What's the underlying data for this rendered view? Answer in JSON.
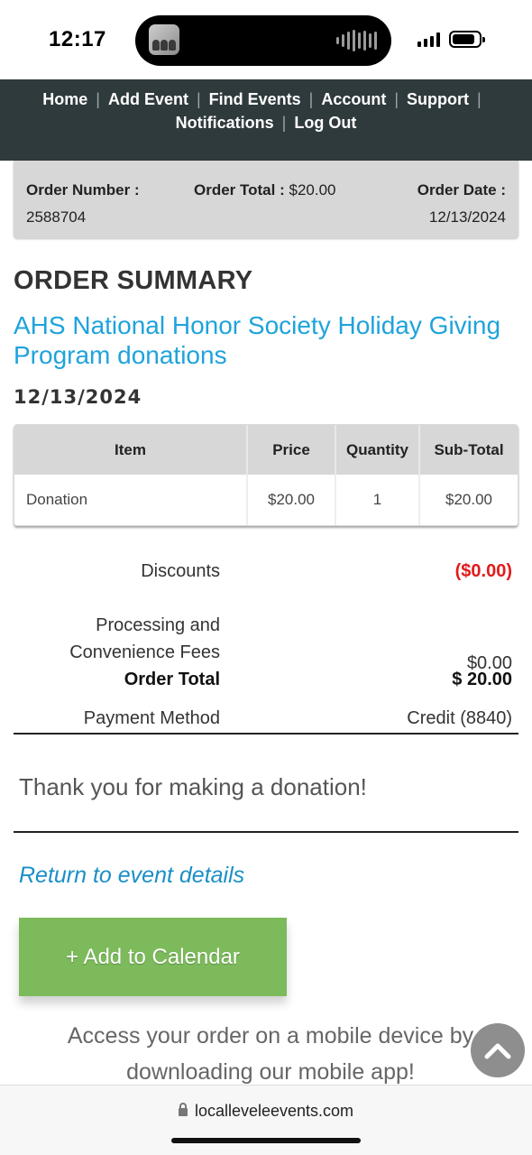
{
  "status": {
    "time": "12:17"
  },
  "nav": {
    "items": [
      "Home",
      "Add Event",
      "Find Events",
      "Account",
      "Support",
      "Notifications",
      "Log Out"
    ],
    "separator": "|"
  },
  "order_info": {
    "number_label": "Order Number :",
    "number": "2588704",
    "total_label": "Order Total :",
    "total": "$20.00",
    "date_label": "Order Date :",
    "date": "12/13/2024"
  },
  "summary": {
    "heading": "ORDER SUMMARY",
    "event_title": "AHS National Honor Society Holiday Giving Program donations",
    "event_date": "12/13/2024"
  },
  "table": {
    "headers": [
      "Item",
      "Price",
      "Quantity",
      "Sub-Total"
    ],
    "rows": [
      [
        "Donation",
        "$20.00",
        "1",
        "$20.00"
      ]
    ]
  },
  "totals": {
    "discounts_label": "Discounts",
    "discounts_value": "($0.00)",
    "fees_label": "Processing and Convenience Fees",
    "fees_value": "$0.00",
    "order_total_label": "Order Total",
    "order_total_value": "$ 20.00",
    "payment_label": "Payment Method",
    "payment_value": "Credit (8840)"
  },
  "thank_you": "Thank you for making a donation!",
  "return_link": "Return to event details",
  "calendar_button": "+ Add to Calendar",
  "app_message": "Access your order on a mobile device by downloading our mobile app!",
  "browser": {
    "url": "localleveleevents.com"
  },
  "colors": {
    "nav_bg": "#2f3a3d",
    "link_blue": "#1fa3dc",
    "button_green": "#7cba5b",
    "discount_red": "#e21b1b"
  }
}
